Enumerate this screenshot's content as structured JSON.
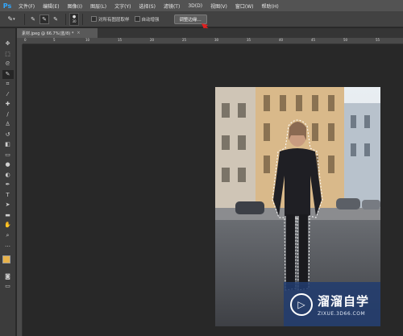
{
  "app": {
    "logo": "Ps"
  },
  "menu": [
    "文件(F)",
    "编辑(E)",
    "图像(I)",
    "图层(L)",
    "文字(Y)",
    "选择(S)",
    "滤镜(T)",
    "3D(D)",
    "视图(V)",
    "窗口(W)",
    "帮助(H)"
  ],
  "options": {
    "brush_size": "30",
    "sample_all_layers": "对所有图层取样",
    "auto_enhance": "自动增强",
    "refine_edge": "调整边缘..."
  },
  "document": {
    "tab_title": "素材.jpeg @ 66.7%(蓝/8) *",
    "close": "×"
  },
  "ruler": [
    "0",
    "5",
    "10",
    "15",
    "20",
    "25",
    "30",
    "35",
    "40",
    "45",
    "50",
    "55"
  ],
  "watermark": {
    "title": "溜溜自学",
    "url": "ZIXUE.3D66.COM"
  },
  "colors": {
    "foreground": "#e8b24a",
    "background": "#ffffff",
    "accent": "#31a8ff",
    "arrow": "#e02020"
  },
  "tools": [
    "move-icon",
    "marquee-icon",
    "lasso-icon",
    "quick-select-icon",
    "crop-icon",
    "eyedropper-icon",
    "healing-brush-icon",
    "brush-icon",
    "clone-stamp-icon",
    "history-brush-icon",
    "eraser-icon",
    "gradient-icon",
    "blur-icon",
    "dodge-icon",
    "pen-icon",
    "type-icon",
    "path-select-icon",
    "shape-icon",
    "hand-icon",
    "zoom-icon"
  ]
}
